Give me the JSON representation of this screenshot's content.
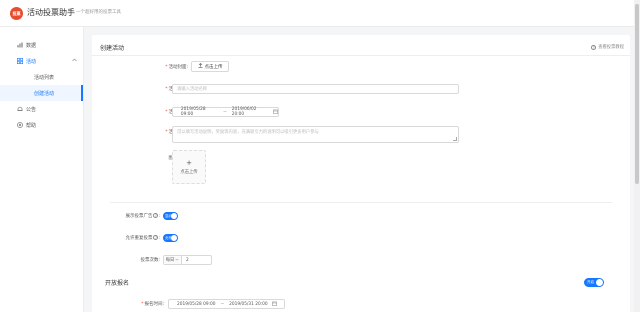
{
  "header": {
    "logo_text": "投票",
    "app_title": "活动投票助手",
    "app_subtitle": "一个超好用的投票工具"
  },
  "sidebar": {
    "items": [
      {
        "label": "数据",
        "icon": "bar-chart-icon"
      },
      {
        "label": "活动",
        "icon": "grid-icon"
      },
      {
        "label": "活动列表"
      },
      {
        "label": "创建活动"
      },
      {
        "label": "公告",
        "icon": "bell-icon"
      },
      {
        "label": "帮助",
        "icon": "help-icon"
      }
    ]
  },
  "form": {
    "title": "创建活动",
    "help_link": "查看投票教程",
    "cover_label": "活动封面",
    "upload_button": "点击上传",
    "name_label": "活动名称",
    "name_placeholder": "请输入活动名称",
    "time_label": "活动时间",
    "time_start": "2019/05/28 09:00",
    "time_end": "2019/06/02 20:00",
    "desc_label": "活动说明",
    "desc_placeholder": "可以填写活动说明，奖励等内容，充满吸引力的说明可以吸引更多用户参与",
    "image_label": "图片说明",
    "image_upload_text": "点击上传",
    "show_ad_label": "展示投票广告",
    "show_ad_value": "显示",
    "repeat_vote_label": "允许重复投票",
    "repeat_vote_value": "允许",
    "vote_count_label": "投票次数",
    "vote_count_period": "每日",
    "vote_count_value": "2",
    "signup_section_title": "开放报名",
    "signup_toggle_value": "开启",
    "signup_time_label": "报名时间",
    "signup_start": "2019/05/28 09:00",
    "signup_end": "2019/05/31 20:00"
  }
}
